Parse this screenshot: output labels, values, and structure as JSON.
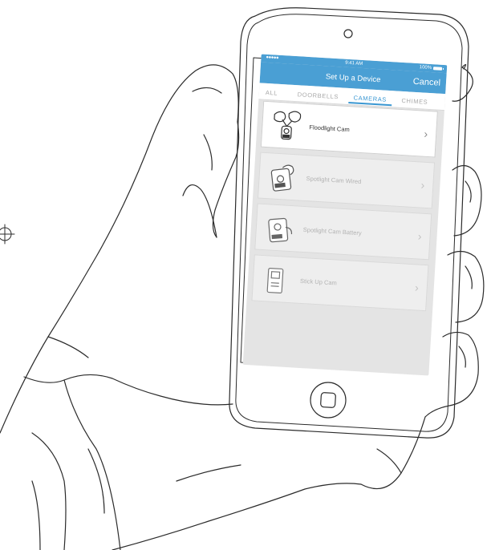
{
  "status_bar": {
    "signal": "●●●●●",
    "time": "9:41 AM",
    "battery": "100%"
  },
  "nav": {
    "title": "Set Up a Device",
    "cancel_label": "Cancel"
  },
  "tabs": [
    {
      "label": "ALL",
      "active": false
    },
    {
      "label": "DOORBELLS",
      "active": false
    },
    {
      "label": "CAMERAS",
      "active": true
    },
    {
      "label": "CHIMES",
      "active": false
    }
  ],
  "devices": [
    {
      "label": "Floodlight Cam",
      "enabled": true,
      "icon": "floodlight-cam-icon"
    },
    {
      "label": "Spotlight Cam Wired",
      "enabled": false,
      "icon": "spotlight-cam-wired-icon"
    },
    {
      "label": "Spotlight Cam Battery",
      "enabled": false,
      "icon": "spotlight-cam-battery-icon"
    },
    {
      "label": "Stick Up Cam",
      "enabled": false,
      "icon": "stick-up-cam-icon"
    }
  ],
  "colors": {
    "accent": "#3a97d2",
    "nav_bg": "#4a9fd4",
    "screen_bg": "#e4e4e4"
  }
}
